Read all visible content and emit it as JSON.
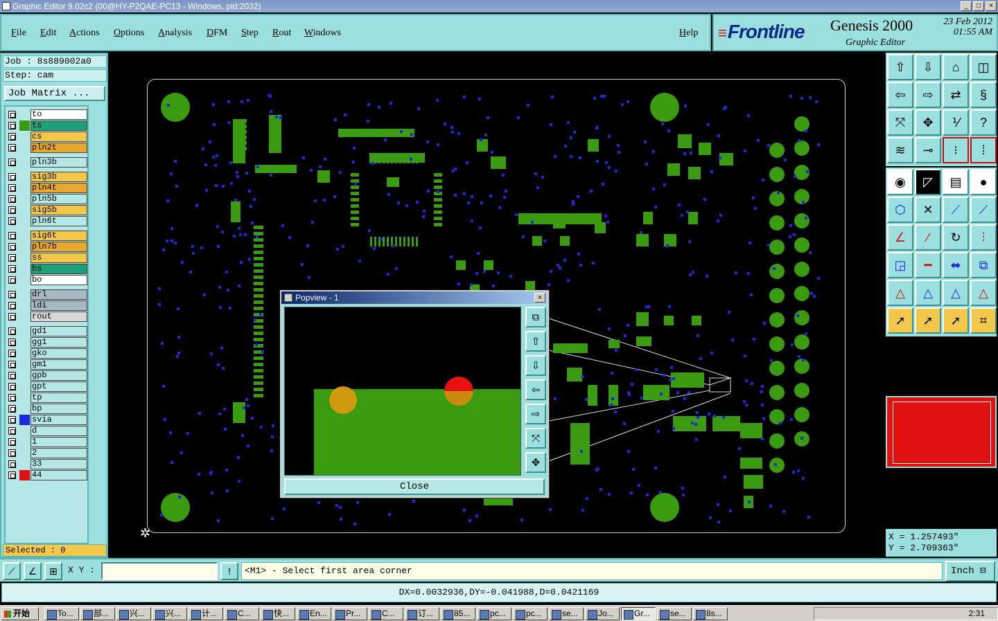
{
  "window": {
    "title": "Graphic Editor 9.02c2 (00@HY-P2QAE-PC13 - Windows, pid:2032)"
  },
  "menu": {
    "items": [
      "File",
      "Edit",
      "Actions",
      "Options",
      "Analysis",
      "DFM",
      "Step",
      "Rout",
      "Windows"
    ],
    "help": "Help"
  },
  "brand": {
    "logo": "Frontline",
    "product": "Genesis 2000",
    "date": "23 Feb 2012",
    "time": "01:55 AM",
    "subtitle": "Graphic Editor"
  },
  "job": {
    "job_label": "Job : 8s889002a0",
    "step_label": "Step: cam",
    "matrix_button": "Job Matrix ..."
  },
  "layers": [
    {
      "name": "to",
      "color": "#ffffff",
      "swatch": ""
    },
    {
      "name": "ts",
      "color": "#1ea07a",
      "swatch": "#3a9a10"
    },
    {
      "name": "cs",
      "color": "#f2c84b",
      "swatch": ""
    },
    {
      "name": "pln2t",
      "color": "#e8a830",
      "swatch": ""
    },
    {
      "name": "pln3b",
      "color": "#b4e7e5",
      "swatch": ""
    },
    {
      "name": "sig3b",
      "color": "#f2c84b",
      "swatch": ""
    },
    {
      "name": "pln4t",
      "color": "#e8a830",
      "swatch": ""
    },
    {
      "name": "pln5b",
      "color": "#b4e7e5",
      "swatch": ""
    },
    {
      "name": "sig5b",
      "color": "#f2c84b",
      "swatch": ""
    },
    {
      "name": "pln6t",
      "color": "#b4e7e5",
      "swatch": ""
    },
    {
      "name": "sig6t",
      "color": "#f2c84b",
      "swatch": ""
    },
    {
      "name": "pln7b",
      "color": "#e8a830",
      "swatch": ""
    },
    {
      "name": "ss",
      "color": "#f2c84b",
      "swatch": ""
    },
    {
      "name": "bs",
      "color": "#1ea07a",
      "swatch": ""
    },
    {
      "name": "bo",
      "color": "#ffffff",
      "swatch": ""
    },
    {
      "name": "drl",
      "color": "#a9b9c4",
      "swatch": ""
    },
    {
      "name": "ldi",
      "color": "#a9b9c4",
      "swatch": ""
    },
    {
      "name": "rout",
      "color": "#d8d8d8",
      "swatch": ""
    },
    {
      "name": "gd1",
      "color": "#b4e7e5",
      "swatch": ""
    },
    {
      "name": "gg1",
      "color": "#b4e7e5",
      "swatch": ""
    },
    {
      "name": "gko",
      "color": "#b4e7e5",
      "swatch": ""
    },
    {
      "name": "gm1",
      "color": "#b4e7e5",
      "swatch": ""
    },
    {
      "name": "gpb",
      "color": "#b4e7e5",
      "swatch": ""
    },
    {
      "name": "gpt",
      "color": "#b4e7e5",
      "swatch": ""
    },
    {
      "name": "tp",
      "color": "#b4e7e5",
      "swatch": ""
    },
    {
      "name": "bp",
      "color": "#b4e7e5",
      "swatch": ""
    },
    {
      "name": "svia",
      "color": "#b4e7e5",
      "swatch": "#1a28e0"
    },
    {
      "name": "d",
      "color": "#b4e7e5",
      "swatch": ""
    },
    {
      "name": "1",
      "color": "#b4e7e5",
      "swatch": ""
    },
    {
      "name": "2",
      "color": "#b4e7e5",
      "swatch": ""
    },
    {
      "name": "33",
      "color": "#b4e7e5",
      "swatch": ""
    },
    {
      "name": "44",
      "color": "#b4e7e5",
      "swatch": "#e01010"
    }
  ],
  "selected": "Selected : 0",
  "popview": {
    "title": "Popview - 1",
    "close_label": "Close"
  },
  "coords": {
    "x": "X = 1.257493\"",
    "y": "Y = 2.709363\""
  },
  "bottom": {
    "xy_label": "X Y :",
    "xy_value": "",
    "message": "<M1> - Select first area corner",
    "unit": "Inch"
  },
  "status": "DX=0.0032936,DY=-0.041988,D=0.0421169",
  "taskbar": {
    "start": "开始",
    "tasks": [
      "To...",
      "部...",
      "兴...",
      "兴...",
      "计...",
      "C...",
      "快...",
      "En...",
      "Pr...",
      "C...",
      "订...",
      "85...",
      "pc...",
      "pc...",
      "se...",
      "Jo...",
      "Gr...",
      "se...",
      "8s..."
    ],
    "clock": "2:31"
  },
  "colors": {
    "panel": "#9be0de",
    "copper": "#3a9a10",
    "via": "#1a28e0",
    "highlight": "#e01010"
  }
}
